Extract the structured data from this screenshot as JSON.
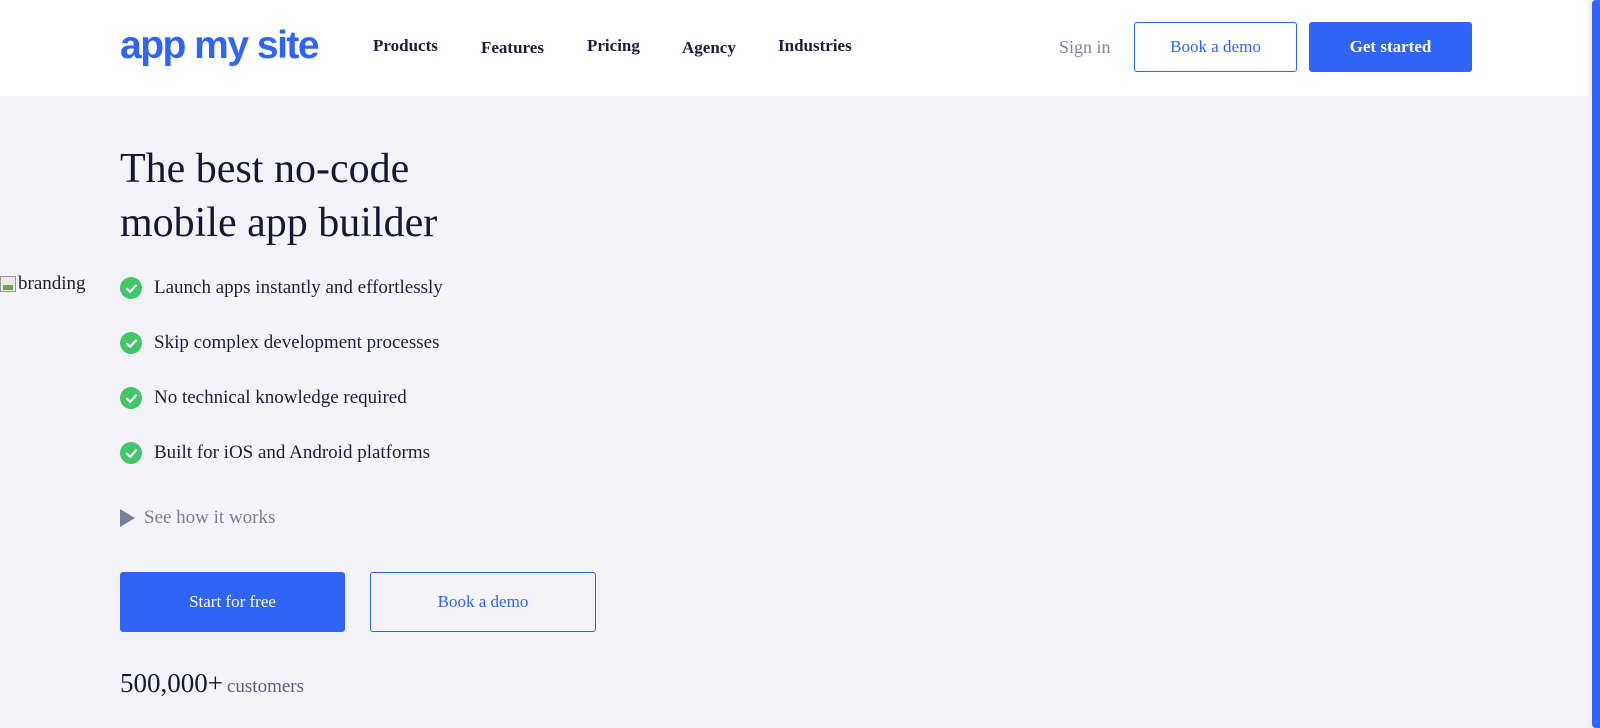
{
  "header": {
    "logo_text": "app my site",
    "nav": [
      {
        "label": "Products"
      },
      {
        "label": "Features"
      },
      {
        "label": "Pricing"
      },
      {
        "label": "Agency"
      },
      {
        "label": "Industries"
      }
    ],
    "signin_label": "Sign in",
    "book_demo_label": "Book a demo",
    "get_started_label": "Get started"
  },
  "hero": {
    "title_line1": "The best no-code",
    "title_line2": "mobile app builder",
    "broken_image_alt": "branding",
    "features": [
      "Launch apps instantly and effortlessly",
      "Skip complex development processes",
      "No technical knowledge required",
      "Built for iOS and Android platforms"
    ],
    "see_how_label": "See how it works",
    "start_free_label": "Start for free",
    "book_demo_label": "Book a demo",
    "customers_count": "500,000+",
    "customers_label": "customers"
  },
  "colors": {
    "brand_blue": "#3064f6",
    "check_green": "#41c76a",
    "page_bg": "#f4f4f8"
  },
  "icons": {
    "check": "check-circle-icon",
    "play": "play-icon",
    "broken_image": "broken-image-icon"
  }
}
